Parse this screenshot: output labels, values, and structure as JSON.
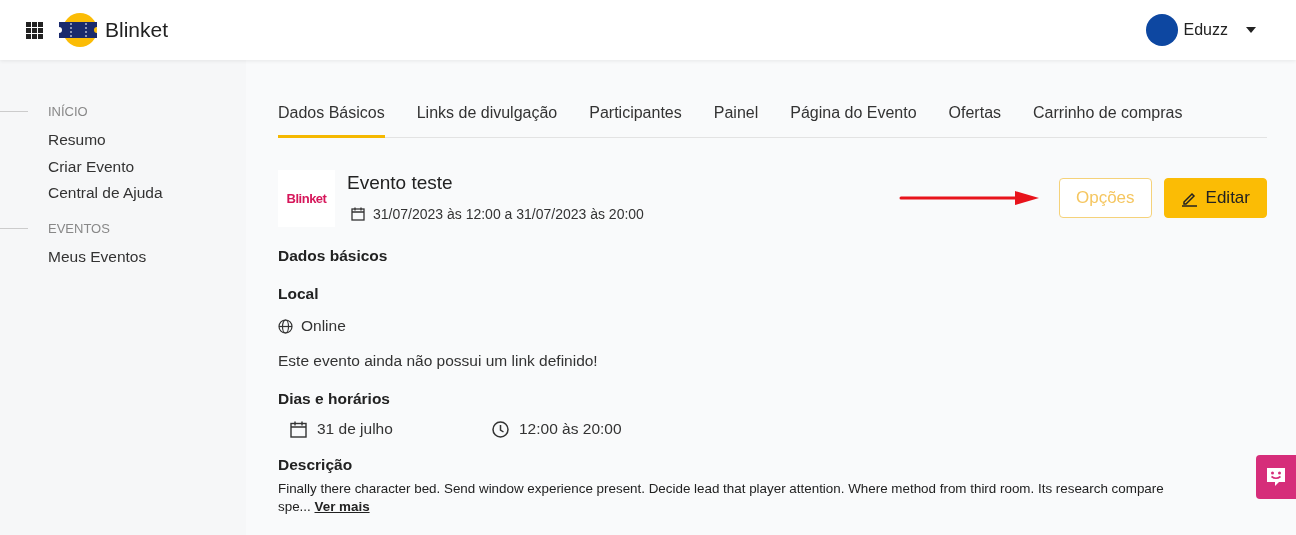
{
  "header": {
    "brand": "Blinket",
    "user": {
      "name": "Eduzz"
    }
  },
  "sidebar": {
    "sections": [
      {
        "title": "INÍCIO",
        "items": [
          {
            "label": "Resumo"
          },
          {
            "label": "Criar Evento"
          },
          {
            "label": "Central de Ajuda"
          }
        ]
      },
      {
        "title": "EVENTOS",
        "items": [
          {
            "label": "Meus Eventos"
          }
        ]
      }
    ]
  },
  "tabs": [
    {
      "label": "Dados Básicos",
      "selected": true
    },
    {
      "label": "Links de divulgação",
      "selected": false
    },
    {
      "label": "Participantes",
      "selected": false
    },
    {
      "label": "Painel",
      "selected": false
    },
    {
      "label": "Página do Evento",
      "selected": false
    },
    {
      "label": "Ofertas",
      "selected": false
    },
    {
      "label": "Carrinho de compras",
      "selected": false
    }
  ],
  "event": {
    "logo_text": "Blinket",
    "title": "Evento teste",
    "period": "31/07/2023 às 12:00 a 31/07/2023 às 20:00"
  },
  "buttons": [
    {
      "label": "Opções",
      "kind": "outline"
    },
    {
      "label": "Editar",
      "kind": "primary"
    }
  ],
  "section_title": "Dados básicos",
  "local": {
    "heading": "Local",
    "mode": "Online",
    "note": "Este evento ainda não possui um link definido!"
  },
  "schedule": {
    "heading": "Dias e horários",
    "date": "31 de julho",
    "time": "12:00 às 20:00"
  },
  "description": {
    "heading": "Descrição",
    "lines": [
      "Finally there character bed. Send window experience present. Decide lead that player attention. Where method from third room. Its research compare",
      "spe..."
    ],
    "link": "Ver mais"
  }
}
